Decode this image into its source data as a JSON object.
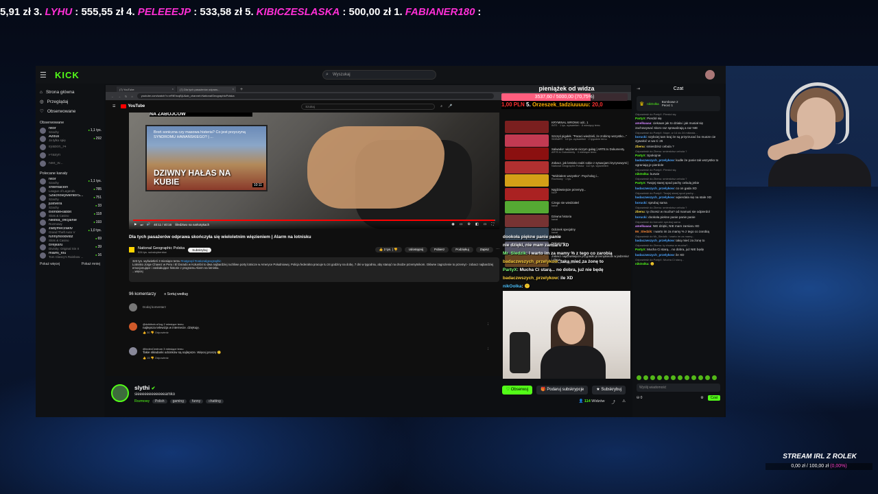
{
  "donors": [
    {
      "amount_prefix": "5,91 zł",
      "rank": "3.",
      "nick": "LYHU",
      "amount": ": 555,55 zł"
    },
    {
      "rank": "4.",
      "nick": "PELEEEJP",
      "amount": ": 533,58 zł"
    },
    {
      "rank": "5.",
      "nick": "KIBICZESLASKA",
      "amount": ": 500,00 zł"
    },
    {
      "rank": "1.",
      "nick": "FABIANER180",
      "amount": ":"
    }
  ],
  "kick": {
    "logo": "KICK",
    "search_placeholder": "Wyszukaj",
    "nav": [
      {
        "icon": "home-icon",
        "label": "Strona główna"
      },
      {
        "icon": "compass-icon",
        "label": "Przeglądaj"
      },
      {
        "icon": "heart-icon",
        "label": "Obserwowane"
      }
    ],
    "followed_title": "Obserwowane",
    "followed": [
      {
        "name": "nitor",
        "category": "Szachy",
        "viewers": "1,1 tys."
      },
      {
        "name": "Azdus",
        "category": "Ja tylko spię",
        "viewers": "292"
      },
      {
        "name": "llyabon_r4",
        "category": "",
        "viewers": "",
        "offline": true
      },
      {
        "name": "Prasyn",
        "category": "",
        "viewers": "",
        "offline": true
      },
      {
        "name": "Nikt_w...",
        "category": "",
        "viewers": "",
        "offline": true
      }
    ],
    "recommended_title": "Polecane kanały",
    "recommended": [
      {
        "name": "nitor",
        "category": "Szachy",
        "viewers": "1,1 tys."
      },
      {
        "name": "xntentacion",
        "category": "League of Legends",
        "viewers": "785"
      },
      {
        "name": "SzachowyMentorS...",
        "category": "Szachy",
        "viewers": "751"
      },
      {
        "name": "justvera",
        "category": "Szachy",
        "viewers": "33"
      },
      {
        "name": "BlondeRabbit",
        "category": "Slots & Casino",
        "viewers": "118"
      },
      {
        "name": "Nikitka_oficjalnie",
        "category": "Rozmowy",
        "viewers": "193"
      },
      {
        "name": "zadymeczaktv",
        "category": "Grand Theft Auto V",
        "viewers": "1,0 tys."
      },
      {
        "name": "funnyhoodvidz",
        "category": "Slots & Casino",
        "viewers": "69"
      },
      {
        "name": "Brejkaru",
        "category": "Divinity: Original Sin II",
        "viewers": "39"
      },
      {
        "name": "miami_fou",
        "category": "Tom Clancy's Rainbow ...",
        "viewers": "16"
      }
    ],
    "show_more": "Pokaż więcej",
    "show_less": "Pokaż mniej",
    "channel": {
      "name": "slythi",
      "title": "sieeeeeeeeeeeeamko",
      "category": "Rozmowy",
      "tags": [
        "Polish",
        "gaming",
        "funny",
        "chatting"
      ],
      "follow": "Obserwuj",
      "gift": "Podaruj subskrypcje",
      "subscribe": "Subskrybuj",
      "viewers_num": "114",
      "viewers_label": "Widzów"
    },
    "chat": {
      "title": "Czat",
      "pinned_lines": [
        "Bombowe",
        "Pecez"
      ],
      "pinned_counts": [
        "2",
        "1"
      ],
      "pinned_user": "nikOolka",
      "messages": [
        {
          "reply": "Odpowiedź do PartyX: Pierdol się",
          "user": "PartyX",
          "color": "ucol-g",
          "text": "Pierdol się"
        },
        {
          "reply": "",
          "user": "amelkaaaa",
          "color": "ucol-p",
          "text": "ciekawe jak to działa i jak musiał się zachowywać skoro raz sprawdzają a raz NIE"
        },
        {
          "reply": "Odpowiedź do PartyX: Nope, w 14 do 24 miliarda...",
          "user": "borucki",
          "color": "ucol-b",
          "text": "szybciej tam kraj że są przyrzucać bo musze cie zgwałcić w wa ti: 26"
        },
        {
          "reply": "",
          "user": "Zbenu",
          "color": "ucol-y",
          "text": "smierdzisz cebula ?"
        },
        {
          "reply": "Odpowiedź do Zbenu: smierdzisz cebula ?",
          "user": "PartyX",
          "color": "ucol-g",
          "text": "Spokojnie"
        },
        {
          "reply": "",
          "user": "badaczwszych_przelykow",
          "color": "ucol-b",
          "text": "kudłe że panie tak wszystko to ograniają je pierdole"
        },
        {
          "reply": "Odpowiedź do PartyX: Pierdol się",
          "user": "nikOolka",
          "color": "ucol-g",
          "text": "kurwie"
        },
        {
          "reply": "Odpowiedź do Zbenu: smierdzisz cebula ?",
          "user": "PartyX",
          "color": "ucol-g",
          "text": "Twojej starej spod pachy cebulą jebie"
        },
        {
          "reply": "",
          "user": "badaczwszych_przelykow",
          "color": "ucol-b",
          "text": "co on gada XD"
        },
        {
          "reply": "Odpowiedź do PartyX: Twojej starej spod pachy...",
          "user": "badaczwszych_przelykow",
          "color": "ucol-b",
          "text": "wpierdala się na stale XD"
        },
        {
          "reply": "",
          "user": "borucki",
          "color": "ucol-b",
          "text": "sprubuj sama"
        },
        {
          "reply": "Odpowiedź do Zbenu: smierdzisz cebula ?",
          "user": "Zbenu",
          "color": "ucol-y",
          "text": "ty chcesz w mucha? od mamusi sie odpierdol"
        },
        {
          "reply": "",
          "user": "borucki",
          "color": "ucol-b",
          "text": "dookoła piekne panie panie panie"
        },
        {
          "reply": "Odpowiedź do borucki: sprubuj sama",
          "user": "amelkaaaa",
          "color": "ucol-p",
          "text": "NIE dzięki, NIE mam zamiaru XD"
        },
        {
          "reply": "",
          "user": "Mr_Sledzik",
          "color": "ucol-o",
          "text": "I warto im za mamy % z tego co zarobią"
        },
        {
          "reply": "Odpowiedź do Mr_Sledzik: I warto im za mamy...",
          "user": "badaczwszych_przelykow",
          "color": "ucol-b",
          "text": "taką mieć za żonę to"
        },
        {
          "reply": "Odpowiedź do Zbenu: ty chcesz w mucha?...",
          "user": "PartyX",
          "color": "ucol-g",
          "text": "Mucha Ci starą... no dobra, już NIE będę"
        },
        {
          "reply": "",
          "user": "badaczwszych_przelykow",
          "color": "ucol-b",
          "text": "ile XD"
        },
        {
          "reply": "Odpowiedź do PartyX: Mucha Ci starą...",
          "user": "nikOolka",
          "color": "ucol-g",
          "text": "🙂"
        }
      ],
      "input_placeholder": "Wyślij wiadomość",
      "send": "Czat",
      "points": "0"
    }
  },
  "browser": {
    "tabs": [
      "(7) YouTube",
      "(7) Dla tych pasażerów odpraw..."
    ],
    "url": "youtube.com/watch?v=eRtEhcqBjU&ab_channel=NationalGeographicPolska",
    "yt_search_placeholder": "Szukaj",
    "video": {
      "top_caption": "NA ZABÓJCÓW",
      "endcard_question": "Broń sonicznа czy masowa histeria? Co jest przyczyną SYNDROMU HAWAŃSKIEGO? | ...",
      "endcard_title": "DZIWNY HAŁAS NA KUBIE",
      "endcard_duration": "10:11",
      "time": "40:11 / 40:16",
      "chapter": "Śledztwo na narkotykach",
      "progress_fraction": 0.998
    },
    "title": "Dla tych pasażerów odprawa skończyła się wieloletnim więzieniem | Alarm na lotnisku",
    "channel_name": "National Geographic Polska",
    "channel_subs": "526 tys. subskrybentów",
    "subscribe": "Subskrybuj",
    "actions": [
      "2 tys.",
      "Udostępnij",
      "Pobierz",
      "Podziękuj",
      "Zapisz"
    ],
    "description": {
      "meta": "323 tys. wyświetleń  3 miesiące temu",
      "tags": "#natgeopl #nationalgeographic",
      "text": "Lotnisko Jorge Chavez w Peru i El Dorado w Kolumbii to dwa najbardziej ruchliwe porty lotnicze w Ameryce Południowej. Policja federalna pracuje tu 24 godziny na dobę, 7 dni w tygodniu, aby stanąć na drodze przemytnikom. Główne zagrożenie to przemyt - zobacz najbardziej emocjonujące i zaskakujące historie z programu Alarm na lotnisku.",
      "more": "...więcej"
    },
    "comments_count": "96 komentarzy",
    "sort": "Sortuj według",
    "add_comment": "Dodaj komentarz",
    "comments": [
      {
        "author": "@dzikibob-sl1zg  2 miesiące temu",
        "text": "najlepsza telewizja w internecie. dziękuję.",
        "likes": "30",
        "reply": "Odpowiedz"
      },
      {
        "author": "@IndexCentrum  3 miesiące temu",
        "text": "Takie składanki odcinków są najlepsze. Więcej proszę 🙂",
        "likes": "15",
        "reply": "Odpowiedz"
      }
    ],
    "recs": [
      {
        "title": "KRYMINAL WRONKI odc. 1",
        "sub": "INTE · 1 tys. wyświetleń · 8 miesięcy temu"
      },
      {
        "title": "Szczęś pigułek. \"Pacaci wiedzieli, że zrobimy wszystko...\"",
        "sub": "SKIBARY · 18 tys. wyświetleń · 2 tygodnie temu"
      },
      {
        "title": "Salwador: więzienie niczym gułag | ARTE.tv Dokumenty",
        "sub": "ARTE.tv Dokumenty · 3 miesiące temu"
      },
      {
        "title": "Zobacz, jak lotnisko radzi sobie z sytuacjami kryzysowymi |",
        "sub": "National Geographic Polska · 112 tys. wyświetleń"
      },
      {
        "title": "\"Widziałem wszystko\". Psycholog i...",
        "sub": "Rozmowy · 1 tys."
      },
      {
        "title": "Najdziwniejsze przemyty...",
        "sub": "NGP"
      },
      {
        "title": "Czego nie wiedziałeś",
        "sub": "kanał"
      },
      {
        "title": "Dziwna historia",
        "sub": "kanał"
      },
      {
        "title": "Odcinek specjalny",
        "sub": "kanał"
      },
      {
        "title": "Dokument",
        "sub": "kanał"
      },
      {
        "title": "Zobacz najdziwniejsze przypadki przemytników w jedzeniu! | Złapa...",
        "sub": "National Geographic Polska"
      }
    ]
  },
  "overlay": {
    "goal_title": "pieniążek od widza",
    "goal_value": "3537,60 / 5000,00 (70,75%)",
    "goal_fraction": 0.7075,
    "goal_ticker_amount": "1,00 PLN",
    "goal_ticker_rank": "5.",
    "goal_ticker_nick": "Orzeszek_tadziuuuuu:",
    "goal_ticker_amount2": "20,0",
    "chat": [
      {
        "user": "",
        "text": "dookoła piękne panie panie",
        "color": ""
      },
      {
        "user": "",
        "text": "nie dzięki, nie mam zamiaru XD",
        "color": ""
      },
      {
        "user": "Mr_Sledzik",
        "text": ": I warto im za mamy % z tego co zarobią",
        "color": "u1"
      },
      {
        "user": "badaczwszych_przelykow",
        "text": ": taką mieć za żonę to",
        "color": "u2"
      },
      {
        "user": "PartyX",
        "text": ": Mucha Ci starą... no dobra, już nie będę",
        "color": "u1"
      },
      {
        "user": "badaczwszych_przelykow",
        "text": ": ile XD",
        "color": "u2"
      },
      {
        "user": "nikOolka",
        "text": ": 🙂",
        "color": "u3"
      }
    ],
    "stream_label": "STREAM IRL Z ROLEK",
    "stream_progress": "0,00 zł / 100,00 zł",
    "stream_pct": "(0,00%)"
  }
}
